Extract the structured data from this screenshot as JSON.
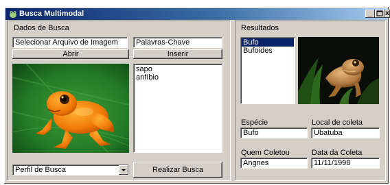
{
  "window": {
    "title": "Busca Multimodal"
  },
  "search": {
    "section_label": "Dados de Busca",
    "image_field": "Selecionar Arquivo de Imagem",
    "keywords_field": "Palavras-Chave",
    "open_button": "Abrir",
    "insert_button": "Inserir",
    "keywords_list": [
      "sapo",
      "anfíbio"
    ],
    "profile_select": "Perfil de Busca",
    "run_button": "Realizar Busca"
  },
  "results": {
    "section_label": "Resultados",
    "items": [
      {
        "label": "Bufo",
        "selected": true
      },
      {
        "label": "Bufoides",
        "selected": false
      }
    ],
    "species_label": "Espécie",
    "species_value": "Bufo",
    "location_label": "Local de coleta",
    "location_value": "Ubatuba",
    "collector_label": "Quem Coletou",
    "collector_value": "Angnes",
    "date_label": "Data da Coleta",
    "date_value": "11/11/1998"
  },
  "colors": {
    "titlebar": "#0a246a",
    "face": "#d4d0c8",
    "selection": "#0a246a"
  }
}
